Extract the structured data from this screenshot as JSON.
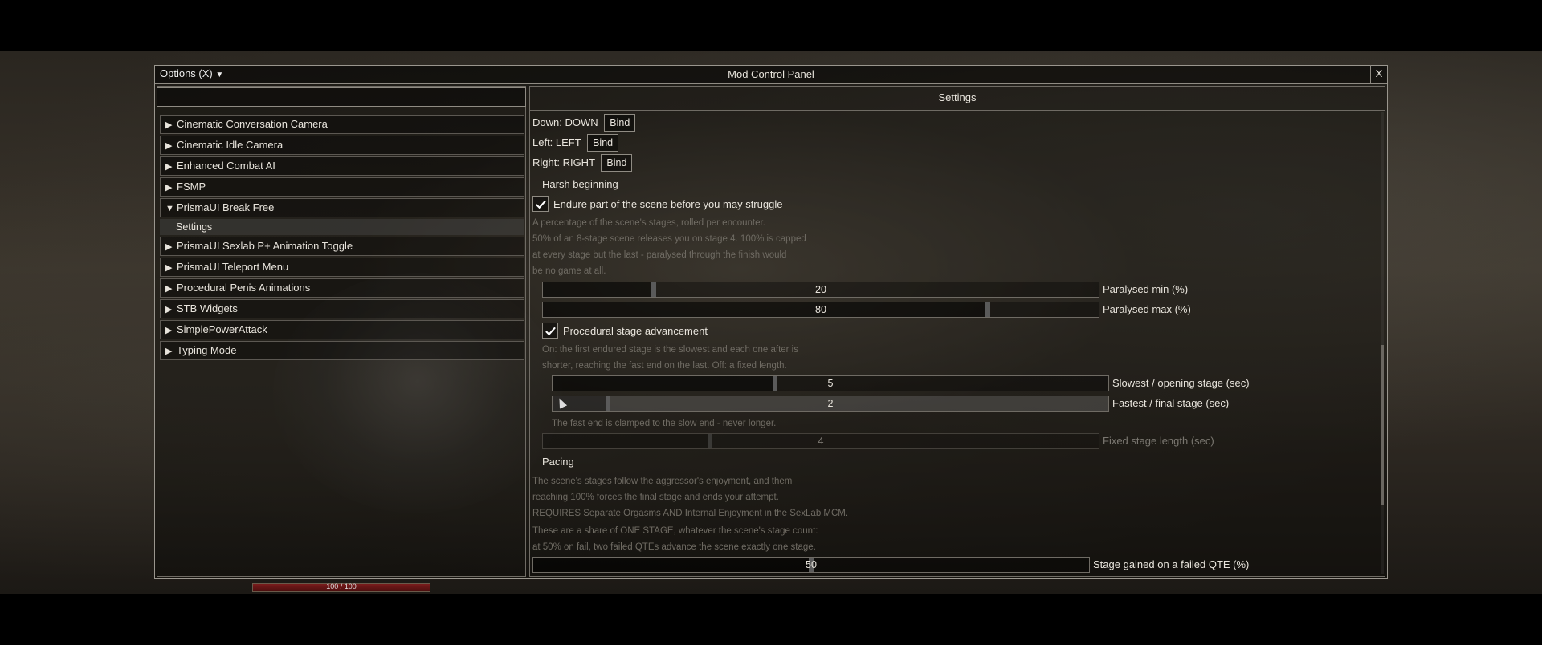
{
  "window": {
    "options_label": "Options (X)",
    "title": "Mod Control Panel",
    "close_label": "X",
    "settings_header": "Settings"
  },
  "mod_list": [
    {
      "arrow": "▶",
      "label": "Cinematic Conversation Camera"
    },
    {
      "arrow": "▶",
      "label": "Cinematic Idle Camera"
    },
    {
      "arrow": "▶",
      "label": "Enhanced Combat AI"
    },
    {
      "arrow": "▶",
      "label": "FSMP"
    },
    {
      "arrow": "▼",
      "label": "PrismaUI Break Free"
    },
    {
      "arrow": "▶",
      "label": "PrismaUI Sexlab P+ Animation Toggle"
    },
    {
      "arrow": "▶",
      "label": "PrismaUI Teleport Menu"
    },
    {
      "arrow": "▶",
      "label": "Procedural Penis Animations"
    },
    {
      "arrow": "▶",
      "label": "STB Widgets"
    },
    {
      "arrow": "▶",
      "label": "SimplePowerAttack"
    },
    {
      "arrow": "▶",
      "label": "Typing Mode"
    }
  ],
  "sub_item": "Settings",
  "binds": [
    {
      "label": "Down: DOWN",
      "button": "Bind"
    },
    {
      "label": "Left: LEFT",
      "button": "Bind"
    },
    {
      "label": "Right: RIGHT",
      "button": "Bind"
    }
  ],
  "harsh": {
    "heading": "Harsh beginning",
    "checkbox_label": "Endure part of the scene before you may struggle",
    "checked": true,
    "desc": [
      "A percentage of the scene's stages, rolled per encounter.",
      "50% of an 8-stage scene releases you on stage 4. 100% is capped",
      "at every stage but the last - paralysed through the finish would",
      "be no game at all."
    ],
    "paralysed_min": {
      "value": "20",
      "label": "Paralysed min (%)",
      "fraction": 0.2
    },
    "paralysed_max": {
      "value": "80",
      "label": "Paralysed max (%)",
      "fraction": 0.8
    }
  },
  "procedural": {
    "checkbox_label": "Procedural stage advancement",
    "checked": true,
    "desc": [
      "On: the first endured stage is the slowest and each one after is",
      "shorter, reaching the fast end on the last. Off: a fixed length."
    ],
    "slowest": {
      "value": "5",
      "label": "Slowest / opening stage (sec)",
      "fraction": 0.4
    },
    "fastest": {
      "value": "2",
      "label": "Fastest / final stage (sec)",
      "fraction": 0.1
    },
    "clamp_note": "The fast end is clamped to the slow end - never longer.",
    "fixed": {
      "value": "4",
      "label": "Fixed stage length (sec)",
      "fraction": 0.3
    }
  },
  "pacing": {
    "heading": "Pacing",
    "desc1": [
      "The scene's stages follow the aggressor's enjoyment, and them",
      "reaching 100% forces the final stage and ends your attempt.",
      "REQUIRES Separate Orgasms AND Internal Enjoyment in the SexLab MCM."
    ],
    "desc2": [
      "These are a share of ONE STAGE, whatever the scene's stage count:",
      "at 50% on fail, two failed QTEs advance the scene exactly one stage."
    ],
    "stage_gained": {
      "value": "50",
      "label": "Stage gained on a failed QTE (%)",
      "fraction": 0.5
    }
  },
  "hud": {
    "health_text": "100 / 100",
    "health_fraction": 1.0
  }
}
